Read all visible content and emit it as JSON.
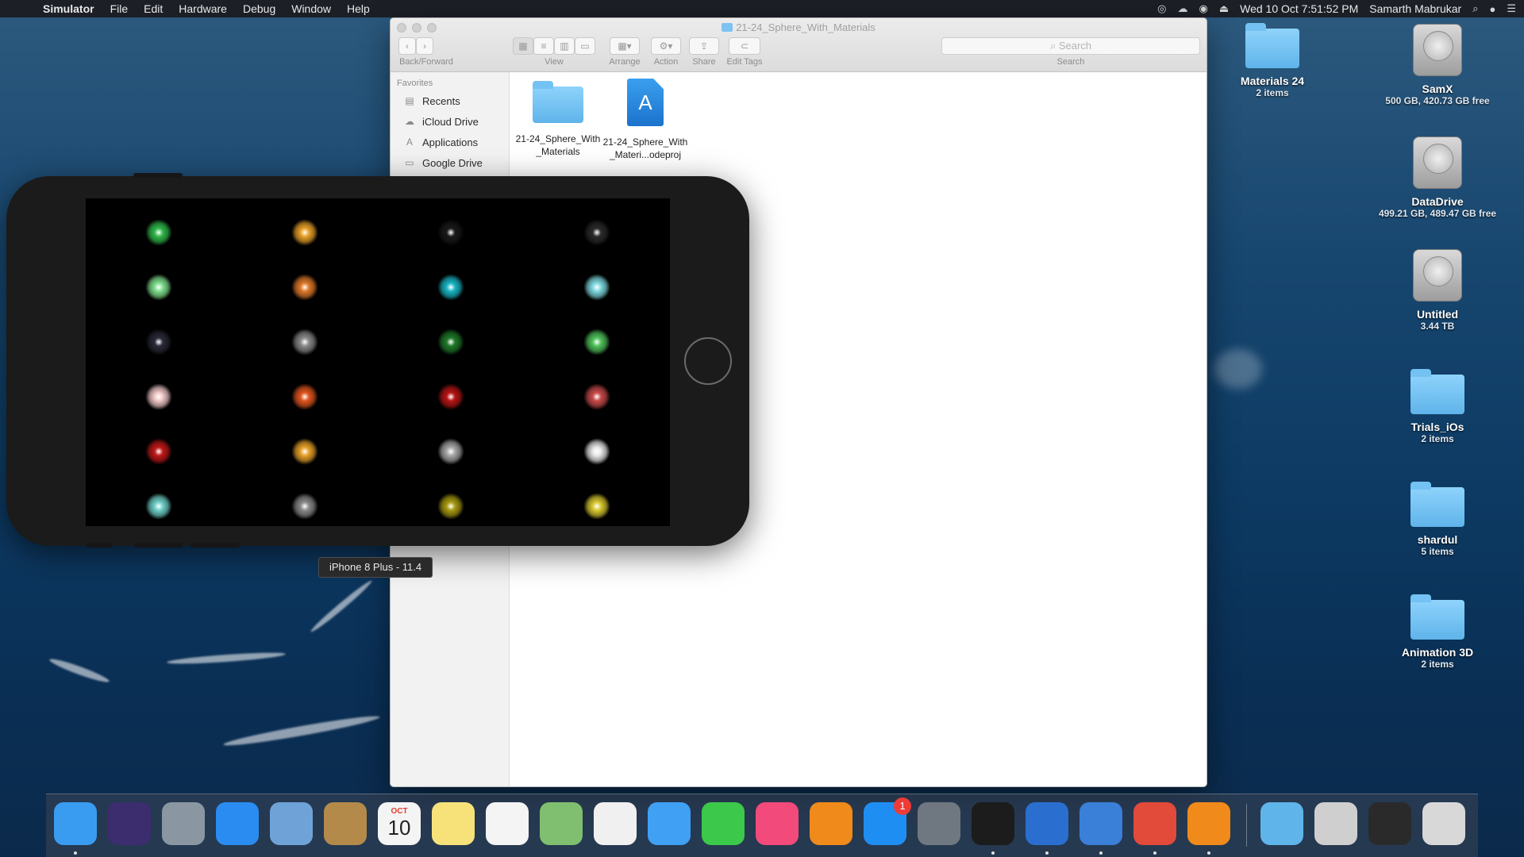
{
  "menubar": {
    "app_name": "Simulator",
    "menus": [
      "File",
      "Edit",
      "Hardware",
      "Debug",
      "Window",
      "Help"
    ],
    "datetime": "Wed 10 Oct  7:51:52 PM",
    "user": "Samarth Mabrukar"
  },
  "finder": {
    "title": "21-24_Sphere_With_Materials",
    "toolbar": {
      "back_forward_label": "Back/Forward",
      "view_label": "View",
      "arrange_label": "Arrange",
      "action_label": "Action",
      "share_label": "Share",
      "edit_tags_label": "Edit Tags",
      "search_label": "Search",
      "search_placeholder": "Search"
    },
    "sidebar": {
      "heading": "Favorites",
      "items": [
        {
          "label": "Recents",
          "icon": "recents-icon"
        },
        {
          "label": "iCloud Drive",
          "icon": "cloud-icon"
        },
        {
          "label": "Applications",
          "icon": "applications-icon"
        },
        {
          "label": "Google Drive",
          "icon": "folder-icon"
        }
      ]
    },
    "files": [
      {
        "name": "21-24_Sphere_With_Materials",
        "kind": "folder"
      },
      {
        "name": "21-24_Sphere_With_Materi...odeproj",
        "kind": "xcodeproj"
      }
    ]
  },
  "simulator": {
    "device_tooltip": "iPhone 8 Plus - 11.4",
    "spheres": [
      [
        "#2fb84a",
        "#e8a22a",
        "#1a1a1a",
        "#2b2b2b"
      ],
      [
        "#7fe08e",
        "#e07a2a",
        "#19b5c4",
        "#7fd9e0"
      ],
      [
        "#2a2a38",
        "#8a8a8a",
        "#1f7a2a",
        "#4fc25a"
      ],
      [
        "#f2c8c8",
        "#e0561f",
        "#b81515",
        "#c84a4a"
      ],
      [
        "#c01818",
        "#e8a22a",
        "#a8a8a8",
        "#e8e8e8"
      ],
      [
        "#6fd0c8",
        "#8a8a8a",
        "#a89a12",
        "#d8c830"
      ]
    ]
  },
  "desktop": {
    "items": [
      {
        "name": "Materials 24",
        "sub": "2 items",
        "kind": "folder"
      },
      {
        "name": "SamX",
        "sub": "500 GB, 420.73 GB free",
        "kind": "hdd"
      },
      {
        "name": "DataDrive",
        "sub": "499.21 GB, 489.47 GB free",
        "kind": "hdd"
      },
      {
        "name": "Untitled",
        "sub": "3.44 TB",
        "kind": "hdd"
      },
      {
        "name": "Trials_iOs",
        "sub": "2 items",
        "kind": "folder"
      },
      {
        "name": "shardul",
        "sub": "5 items",
        "kind": "folder"
      },
      {
        "name": "Animation 3D",
        "sub": "2 items",
        "kind": "folder"
      }
    ]
  },
  "dock": {
    "calendar_month": "OCT",
    "calendar_day": "10",
    "app_store_badge": "1",
    "apps": [
      {
        "icon": "finder-icon",
        "color": "#3a9cf0",
        "running": true
      },
      {
        "icon": "siri-icon",
        "color": "#3b2d6e",
        "running": false
      },
      {
        "icon": "launchpad-icon",
        "color": "#8b96a3",
        "running": false
      },
      {
        "icon": "safari-icon",
        "color": "#2a8cf0",
        "running": false
      },
      {
        "icon": "preview-icon",
        "color": "#6fa3d8",
        "running": false
      },
      {
        "icon": "contacts-icon",
        "color": "#b38a4a",
        "running": false
      },
      {
        "icon": "calendar-icon",
        "color": "#f4f4f4",
        "running": false
      },
      {
        "icon": "notes-icon",
        "color": "#f7e27a",
        "running": false
      },
      {
        "icon": "reminders-icon",
        "color": "#f4f4f4",
        "running": false
      },
      {
        "icon": "maps-icon",
        "color": "#7fbf6f",
        "running": false
      },
      {
        "icon": "photos-icon",
        "color": "#f0f0f0",
        "running": false
      },
      {
        "icon": "messages-icon",
        "color": "#3fa0f4",
        "running": false
      },
      {
        "icon": "facetime-icon",
        "color": "#3cc84a",
        "running": false
      },
      {
        "icon": "itunes-icon",
        "color": "#f24a7a",
        "running": false
      },
      {
        "icon": "ibooks-icon",
        "color": "#f08a1a",
        "running": false
      },
      {
        "icon": "app-store-icon",
        "color": "#1f8ef2",
        "running": false
      },
      {
        "icon": "system-preferences-icon",
        "color": "#6f7780",
        "running": false
      },
      {
        "icon": "terminal-icon",
        "color": "#1c1c1c",
        "running": true
      },
      {
        "icon": "xcode-icon",
        "color": "#2a6fd0",
        "running": true
      },
      {
        "icon": "xcode-dev-icon",
        "color": "#3a7fd8",
        "running": true
      },
      {
        "icon": "chrome-icon",
        "color": "#e24a3a",
        "running": true
      },
      {
        "icon": "sublime-icon",
        "color": "#f08a1a",
        "running": true
      }
    ],
    "right_items": [
      {
        "icon": "documents-stack-icon",
        "color": "#5fb4ea"
      },
      {
        "icon": "chrome-window-icon",
        "color": "#cfcfcf"
      },
      {
        "icon": "sublime-window-icon",
        "color": "#2a2a2a"
      },
      {
        "icon": "trash-icon",
        "color": "#d8d8d8"
      }
    ]
  }
}
